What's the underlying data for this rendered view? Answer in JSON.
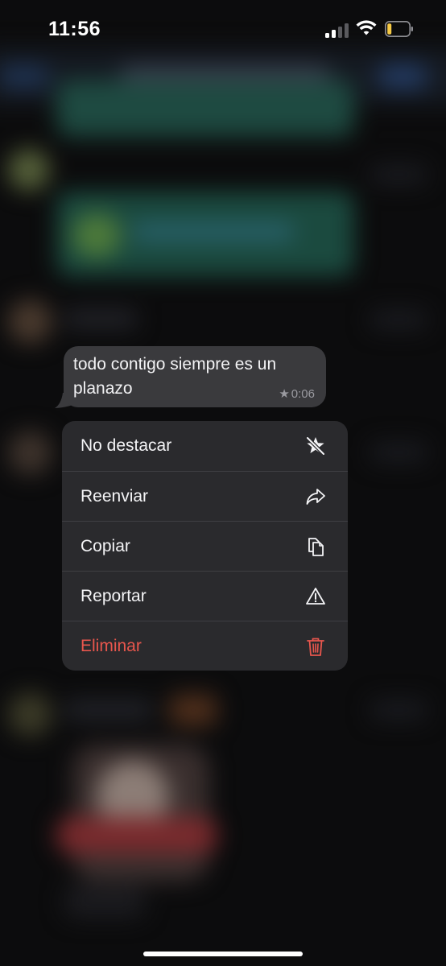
{
  "status_bar": {
    "time": "11:56",
    "battery_color": "#f5c945"
  },
  "message": {
    "text": "todo contigo siempre es un planazo",
    "time": "0:06",
    "starred": true
  },
  "context_menu": {
    "items": [
      {
        "label": "No destacar",
        "icon": "unstar-icon",
        "color": "#f4f4f6"
      },
      {
        "label": "Reenviar",
        "icon": "forward-icon",
        "color": "#f4f4f6"
      },
      {
        "label": "Copiar",
        "icon": "copy-icon",
        "color": "#f4f4f6"
      },
      {
        "label": "Reportar",
        "icon": "warning-icon",
        "color": "#f4f4f6"
      },
      {
        "label": "Eliminar",
        "icon": "trash-icon",
        "color": "#e8564d"
      }
    ]
  }
}
